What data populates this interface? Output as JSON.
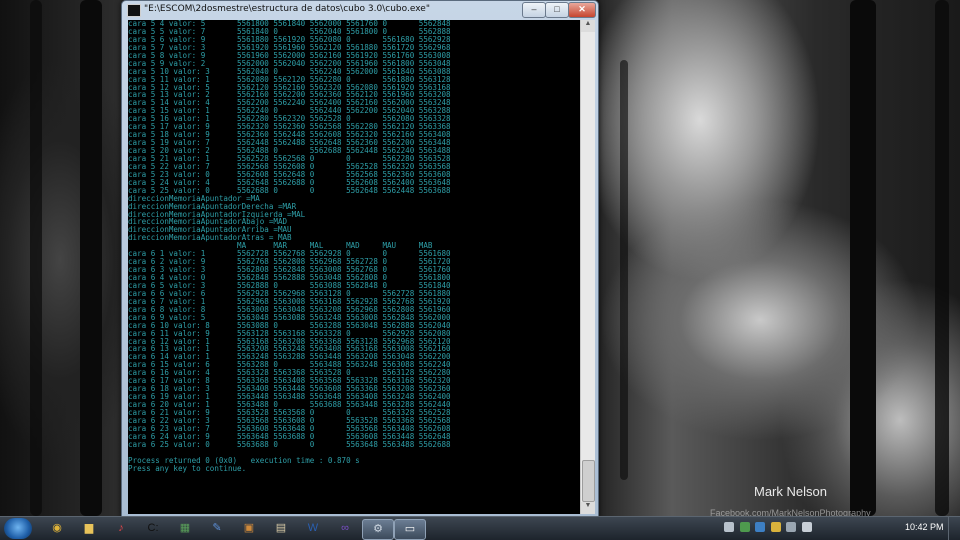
{
  "window": {
    "title": "\"E:\\ESCOM\\2dosmestre\\estructura de datos\\cubo 3.0\\cubo.exe\"",
    "minimize_glyph": "–",
    "maximize_glyph": "□",
    "close_glyph": "✕"
  },
  "console": {
    "lines": [
      "cara 5 4 valor: 5       5561800 5561840 5562000 5561760 0       5562848",
      "cara 5 5 valor: 7       5561840 0       5562040 5561800 0       5562888",
      "cara 5 6 valor: 9       5561880 5561920 5562080 0       5561680 5562928",
      "cara 5 7 valor: 3       5561920 5561960 5562120 5561880 5561720 5562968",
      "cara 5 8 valor: 9       5561960 5562000 5562160 5561920 5561760 5563008",
      "cara 5 9 valor: 2       5562000 5562040 5562200 5561960 5561800 5563048",
      "cara 5 10 valor: 3      5562040 0       5562240 5562000 5561840 5563088",
      "cara 5 11 valor: 1      5562080 5562120 5562280 0       5561880 5563128",
      "cara 5 12 valor: 5      5562120 5562160 5562320 5562080 5561920 5563168",
      "cara 5 13 valor: 2      5562160 5562200 5562360 5562120 5561960 5563208",
      "cara 5 14 valor: 4      5562200 5562240 5562400 5562160 5562000 5563248",
      "cara 5 15 valor: 1      5562240 0       5562440 5562200 5562040 5563288",
      "cara 5 16 valor: 1      5562280 5562320 5562528 0       5562080 5563328",
      "cara 5 17 valor: 9      5562320 5562360 5562568 5562280 5562120 5563368",
      "cara 5 18 valor: 9      5562360 5562448 5562608 5562320 5562160 5563408",
      "cara 5 19 valor: 7      5562448 5562488 5562648 5562360 5562200 5563448",
      "cara 5 20 valor: 2      5562488 0       5562688 5562448 5562240 5563488",
      "cara 5 21 valor: 1      5562528 5562568 0       0       5562280 5563528",
      "cara 5 22 valor: 7      5562568 5562608 0       5562528 5562320 5563568",
      "cara 5 23 valor: 0      5562608 5562648 0       5562568 5562360 5563608",
      "cara 5 24 valor: 4      5562648 5562688 0       5562608 5562400 5563648",
      "cara 5 25 valor: 0      5562688 0       0       5562648 5562448 5563688",
      "direccionMemoriaApuntador =MA",
      "direccionMemoriaApuntadorDerecha =MAR",
      "direccionMemoriaApuntadorIzquierda =MAL",
      "direccionMemoriaApuntadorAbajo =MAD",
      "direccionMemoriaApuntadorArriba =MAU",
      "direccionMemoriaApuntadorAtras = MAB",
      "                        MA      MAR     MAL     MAD     MAU     MAB",
      "cara 6 1 valor: 1       5562728 5562768 5562928 0       0       5561680",
      "cara 6 2 valor: 9       5562768 5562808 5562968 5562728 0       5561720",
      "cara 6 3 valor: 3       5562808 5562848 5563008 5562768 0       5561760",
      "cara 6 4 valor: 0       5562848 5562888 5563048 5562808 0       5561800",
      "cara 6 5 valor: 3       5562888 0       5563088 5562848 0       5561840",
      "cara 6 6 valor: 6       5562928 5562968 5563128 0       5562728 5561880",
      "cara 6 7 valor: 1       5562968 5563008 5563168 5562928 5562768 5561920",
      "cara 6 8 valor: 8       5563008 5563048 5563208 5562968 5562808 5561960",
      "cara 6 9 valor: 5       5563048 5563088 5563248 5563008 5562848 5562000",
      "cara 6 10 valor: 8      5563088 0       5563288 5563048 5562888 5562040",
      "cara 6 11 valor: 9      5563128 5563168 5563328 0       5562928 5562080",
      "cara 6 12 valor: 1      5563168 5563208 5563368 5563128 5562968 5562120",
      "cara 6 13 valor: 1      5563208 5563248 5563408 5563168 5563008 5562160",
      "cara 6 14 valor: 1      5563248 5563288 5563448 5563208 5563048 5562200",
      "cara 6 15 valor: 6      5563288 0       5563488 5563248 5563088 5562240",
      "cara 6 16 valor: 4      5563328 5563368 5563528 0       5563128 5562280",
      "cara 6 17 valor: 8      5563368 5563408 5563568 5563328 5563168 5562320",
      "cara 6 18 valor: 3      5563408 5563448 5563608 5563368 5563208 5562360",
      "cara 6 19 valor: 1      5563448 5563488 5563648 5563408 5563248 5562400",
      "cara 6 20 valor: 1      5563488 0       5563688 5563448 5563288 5562440",
      "cara 6 21 valor: 9      5563528 5563568 0       0       5563328 5562528",
      "cara 6 22 valor: 3      5563568 5563608 0       5563528 5563368 5562568",
      "cara 6 23 valor: 7      5563608 5563648 0       5563568 5563408 5562608",
      "cara 6 24 valor: 9      5563648 5563688 0       5563608 5563448 5562648",
      "cara 6 25 valor: 0      5563688 0       0       5563648 5563488 5562688",
      "",
      "Process returned 0 (0x0)   execution time : 0.870 s",
      "Press any key to continue."
    ]
  },
  "wallpaper": {
    "watermark_title": "Mark Nelson",
    "watermark_sub": "Facebook.com/MarkNelsonPhotography"
  },
  "taskbar": {
    "items": [
      {
        "name": "chrome",
        "glyph": "◉",
        "color": "#e0b43a"
      },
      {
        "name": "explorer",
        "glyph": "▆",
        "color": "#e8c35a"
      },
      {
        "name": "itunes",
        "glyph": "♪",
        "color": "#e4454a"
      },
      {
        "name": "cmd",
        "glyph": "C:",
        "color": "#111"
      },
      {
        "name": "control-panel",
        "glyph": "▦",
        "color": "#5aa05a"
      },
      {
        "name": "edit",
        "glyph": "✎",
        "color": "#5d8fd6"
      },
      {
        "name": "paint",
        "glyph": "▣",
        "color": "#d08a3b"
      },
      {
        "name": "notes",
        "glyph": "▤",
        "color": "#d6c9a6"
      },
      {
        "name": "word",
        "glyph": "W",
        "color": "#2a5fb0"
      },
      {
        "name": "visual-studio",
        "glyph": "∞",
        "color": "#7a4fc6"
      },
      {
        "name": "codeblocks-active",
        "glyph": "⚙",
        "color": "#cfd8e3"
      },
      {
        "name": "console-active",
        "glyph": "▭",
        "color": "#ffffff"
      }
    ],
    "clock": "10:42 PM"
  },
  "colors": {
    "console_text": "#2e9fa8",
    "console_bg": "#000000"
  }
}
